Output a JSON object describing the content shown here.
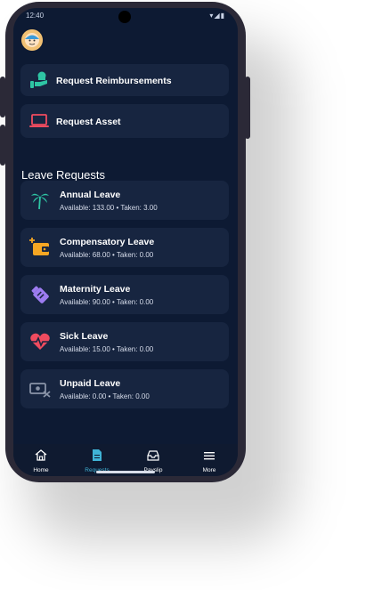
{
  "status": {
    "time": "12:40",
    "icons": "▾◢▮"
  },
  "quick_actions": [
    {
      "label": "Request Reimbursements",
      "icon": "hand-money-icon"
    },
    {
      "label": "Request Asset",
      "icon": "laptop-icon"
    }
  ],
  "section_title": "Leave Requests",
  "leaves": [
    {
      "name": "Annual Leave",
      "summary": "Available: 133.00 • Taken: 3.00",
      "icon": "palm-tree-icon",
      "color": "#2ec5a4"
    },
    {
      "name": "Compensatory Leave",
      "summary": "Available: 68.00 • Taken: 0.00",
      "icon": "wallet-plus-icon",
      "color": "#f5a623"
    },
    {
      "name": "Maternity Leave",
      "summary": "Available: 90.00 • Taken: 0.00",
      "icon": "baby-bottle-icon",
      "color": "#9d7cf0"
    },
    {
      "name": "Sick Leave",
      "summary": "Available: 15.00 • Taken: 0.00",
      "icon": "heartbeat-icon",
      "color": "#ef4b5f"
    },
    {
      "name": "Unpaid Leave",
      "summary": "Available: 0.00 • Taken: 0.00",
      "icon": "money-off-icon",
      "color": "#8a94a8"
    }
  ],
  "nav": [
    {
      "label": "Home",
      "icon": "home-icon"
    },
    {
      "label": "Requests",
      "icon": "document-icon",
      "active": true
    },
    {
      "label": "Payslip",
      "icon": "inbox-icon"
    },
    {
      "label": "More",
      "icon": "menu-icon"
    }
  ],
  "colors": {
    "background": "#0d1a33",
    "card": "#172540",
    "accent": "#3fb3d6"
  }
}
